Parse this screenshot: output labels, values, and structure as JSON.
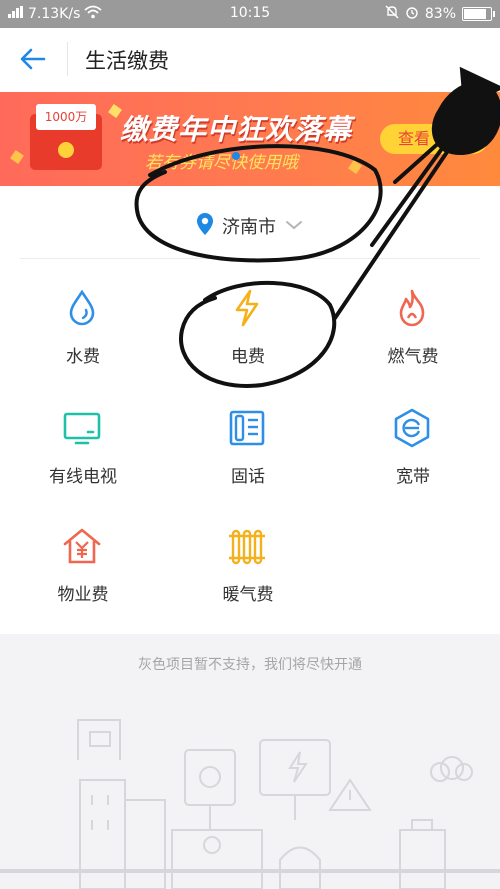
{
  "status_bar": {
    "network_speed": "7.13K/s",
    "time": "10:15",
    "battery_percent": "83%",
    "battery_level": 0.83
  },
  "header": {
    "title": "生活缴费"
  },
  "banner": {
    "envelope_amount": "1000万",
    "headline": "缴费年中狂欢落幕",
    "subline": "若有券请尽快使用哦",
    "cta": "查看"
  },
  "location": {
    "city": "济南市"
  },
  "services": [
    {
      "label": "水费",
      "icon": "water-drop-icon",
      "color": "#2f8fe6"
    },
    {
      "label": "电费",
      "icon": "lightning-icon",
      "color": "#f5b11b"
    },
    {
      "label": "燃气费",
      "icon": "flame-icon",
      "color": "#f0664f"
    },
    {
      "label": "有线电视",
      "icon": "tv-icon",
      "color": "#1fc0a8"
    },
    {
      "label": "固话",
      "icon": "telephone-icon",
      "color": "#2f8fe6"
    },
    {
      "label": "宽带",
      "icon": "broadband-icon",
      "color": "#2f8fe6"
    },
    {
      "label": "物业费",
      "icon": "property-house-icon",
      "color": "#f0664f"
    },
    {
      "label": "暖气费",
      "icon": "radiator-icon",
      "color": "#f5b11b"
    }
  ],
  "footer_note": "灰色项目暂不支持，我们将尽快开通",
  "colors": {
    "accent_blue": "#1e88e5",
    "banner_red": "#ff6a5a",
    "gray_background": "#f3f3f6"
  }
}
